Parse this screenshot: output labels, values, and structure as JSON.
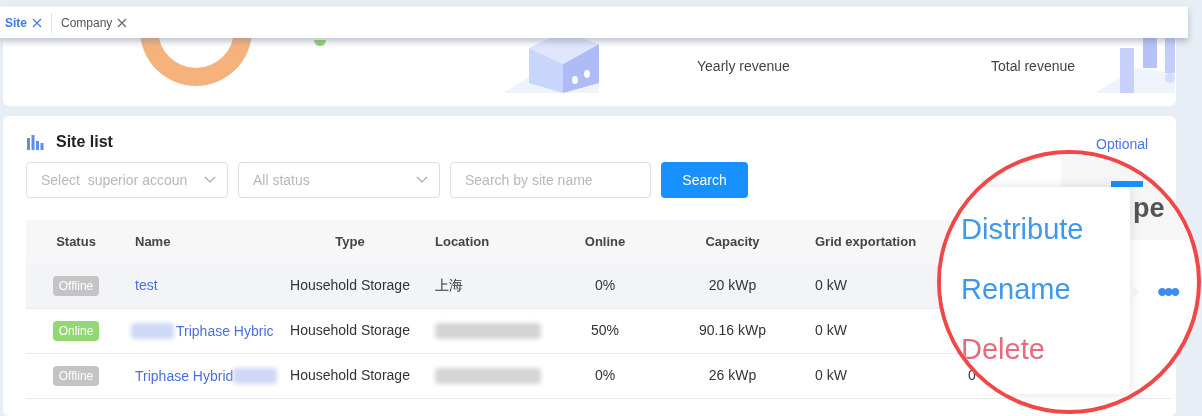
{
  "tabs": [
    {
      "label": "Site",
      "selected": true
    },
    {
      "label": "Company",
      "selected": false
    }
  ],
  "stats": [
    {
      "label": "Yearly revenue"
    },
    {
      "label": "Total revenue"
    }
  ],
  "site_list": {
    "title": "Site list",
    "optional_link": "Optional",
    "filters": {
      "account_placeholder": "Select  superior accoun",
      "status_placeholder": "All status",
      "search_placeholder": "Search by site name",
      "search_button": "Search"
    },
    "table": {
      "columns": [
        "Status",
        "Name",
        "Type",
        "Location",
        "Online",
        "Capacity",
        "Grid exportation"
      ],
      "rows": [
        {
          "status": "Offline",
          "online_status": false,
          "name": "test",
          "blur_before_name": false,
          "blur_after_name": false,
          "type": "Household Storage",
          "location": "上海",
          "location_blurred": false,
          "online": "0%",
          "capacity": "20 kWp",
          "grid_exportation": "0 kW",
          "selected": true
        },
        {
          "status": "Online",
          "online_status": true,
          "name": "Triphase Hybric",
          "blur_before_name": true,
          "blur_after_name": false,
          "type": "Household Storage",
          "location_blurred": true,
          "online": "50%",
          "capacity": "90.16 kWp",
          "grid_exportation": "0 kW",
          "selected": false
        },
        {
          "status": "Offline",
          "online_status": false,
          "name": "Triphase Hybrid",
          "blur_before_name": false,
          "blur_after_name": true,
          "type": "Household Storage",
          "location_blurred": true,
          "online": "0%",
          "capacity": "26 kWp",
          "grid_exportation": "0 kW",
          "column_8": "0",
          "selected": false
        }
      ]
    }
  },
  "magnifier": {
    "header": "pe",
    "more": "•••",
    "menu": [
      {
        "label": "Distribute",
        "kind": "normal"
      },
      {
        "label": "Rename",
        "kind": "normal"
      },
      {
        "label": "Delete",
        "kind": "danger"
      }
    ]
  }
}
